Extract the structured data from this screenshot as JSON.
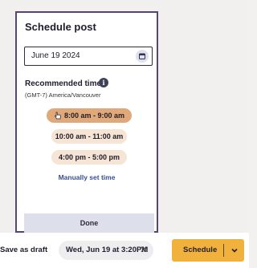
{
  "dialog": {
    "title": "Schedule post",
    "date_value": "June 19 2024",
    "calendar_icon": "calendar-icon",
    "recommended_label": "Recommended times",
    "info_icon": "i",
    "timezone": "(GMT-7) America/Vancouver",
    "time_slots": [
      {
        "label": "8:00 am - 9:00 am",
        "selected": true
      },
      {
        "label": "10:00 am - 11:00 am",
        "selected": false
      },
      {
        "label": "4:00 pm - 5:00 pm",
        "selected": false
      }
    ],
    "manual_link": "Manually set time",
    "done_label": "Done"
  },
  "footer": {
    "draft_label": "Save as draft",
    "scheduled_chip": "Wed, Jun 19 at 3:20PM",
    "clear_icon": "✕",
    "schedule_label": "Schedule",
    "colors": {
      "schedule_button": "#f0b23c",
      "selected_slot": "#e1a97a",
      "slot": "#f6e4d4",
      "dialog_border": "#54466f",
      "link": "#3a4d8f"
    }
  }
}
